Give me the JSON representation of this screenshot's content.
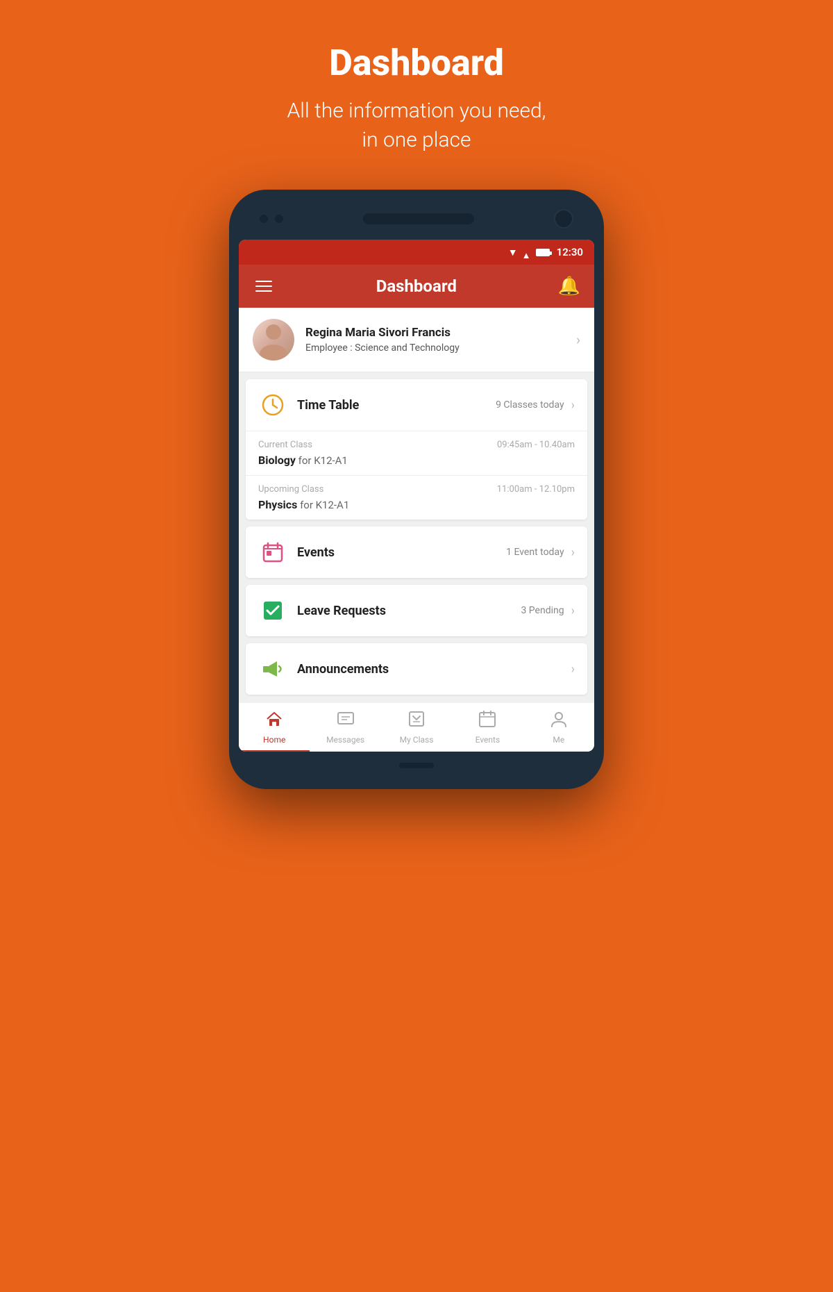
{
  "page": {
    "background_color": "#E8621A",
    "header": {
      "title": "Dashboard",
      "subtitle_line1": "All the information you need,",
      "subtitle_line2": "in one place"
    }
  },
  "status_bar": {
    "time": "12:30"
  },
  "app_bar": {
    "title": "Dashboard"
  },
  "user_card": {
    "name": "Regina Maria Sivori Francis",
    "role_label": "Employee : ",
    "role_value": "Science and Technology"
  },
  "timetable_card": {
    "title": "Time Table",
    "badge": "9 Classes today",
    "current_class": {
      "label": "Current Class",
      "time": "09:45am - 10.40am",
      "subject": "Biology",
      "group": " for K12-A1"
    },
    "upcoming_class": {
      "label": "Upcoming Class",
      "time": "11:00am - 12.10pm",
      "subject": "Physics",
      "group": " for K12-A1"
    }
  },
  "events_card": {
    "title": "Events",
    "badge": "1 Event today"
  },
  "leave_card": {
    "title": "Leave Requests",
    "badge": "3 Pending"
  },
  "announcements_card": {
    "title": "Announcements",
    "badge": ""
  },
  "bottom_nav": {
    "items": [
      {
        "id": "home",
        "label": "Home",
        "active": true
      },
      {
        "id": "messages",
        "label": "Messages",
        "active": false
      },
      {
        "id": "myclass",
        "label": "My Class",
        "active": false
      },
      {
        "id": "events",
        "label": "Events",
        "active": false
      },
      {
        "id": "me",
        "label": "Me",
        "active": false
      }
    ]
  }
}
